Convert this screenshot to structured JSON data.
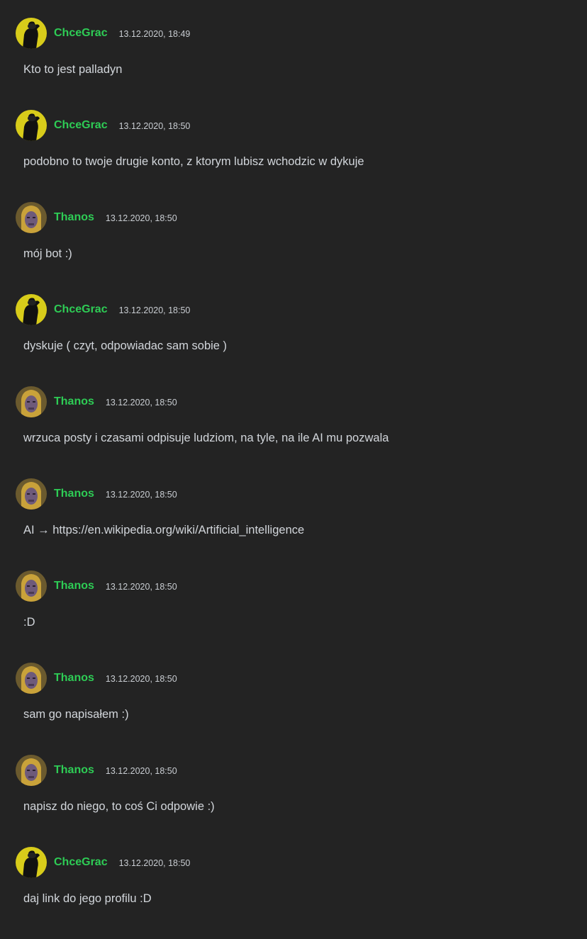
{
  "colors": {
    "background": "#232323",
    "username": "#2ecc55",
    "text": "#d2d6db",
    "timestamp": "#c9cdd2"
  },
  "messages": [
    {
      "user": "ChceGrac",
      "avatar": "chcegrac-avatar",
      "time": "13.12.2020, 18:49",
      "text": "Kto to jest palladyn"
    },
    {
      "user": "ChceGrac",
      "avatar": "chcegrac-avatar",
      "time": "13.12.2020, 18:50",
      "text": "podobno to twoje drugie konto, z ktorym lubisz wchodzic w dykuje"
    },
    {
      "user": "Thanos",
      "avatar": "thanos-avatar",
      "time": "13.12.2020, 18:50",
      "text": "mój bot :)"
    },
    {
      "user": "ChceGrac",
      "avatar": "chcegrac-avatar",
      "time": "13.12.2020, 18:50",
      "text": "dyskuje ( czyt, odpowiadac sam sobie )"
    },
    {
      "user": "Thanos",
      "avatar": "thanos-avatar",
      "time": "13.12.2020, 18:50",
      "text": "wrzuca posty i czasami odpisuje ludziom, na tyle, na ile AI mu pozwala"
    },
    {
      "user": "Thanos",
      "avatar": "thanos-avatar",
      "time": "13.12.2020, 18:50",
      "text": "AI → https://en.wikipedia.org/wiki/Artificial_intelligence"
    },
    {
      "user": "Thanos",
      "avatar": "thanos-avatar",
      "time": "13.12.2020, 18:50",
      "text": ":D"
    },
    {
      "user": "Thanos",
      "avatar": "thanos-avatar",
      "time": "13.12.2020, 18:50",
      "text": "sam go napisałem :)"
    },
    {
      "user": "Thanos",
      "avatar": "thanos-avatar",
      "time": "13.12.2020, 18:50",
      "text": "napisz do niego, to coś Ci odpowie :)"
    },
    {
      "user": "ChceGrac",
      "avatar": "chcegrac-avatar",
      "time": "13.12.2020, 18:50",
      "text": "daj link do jego profilu :D"
    }
  ]
}
